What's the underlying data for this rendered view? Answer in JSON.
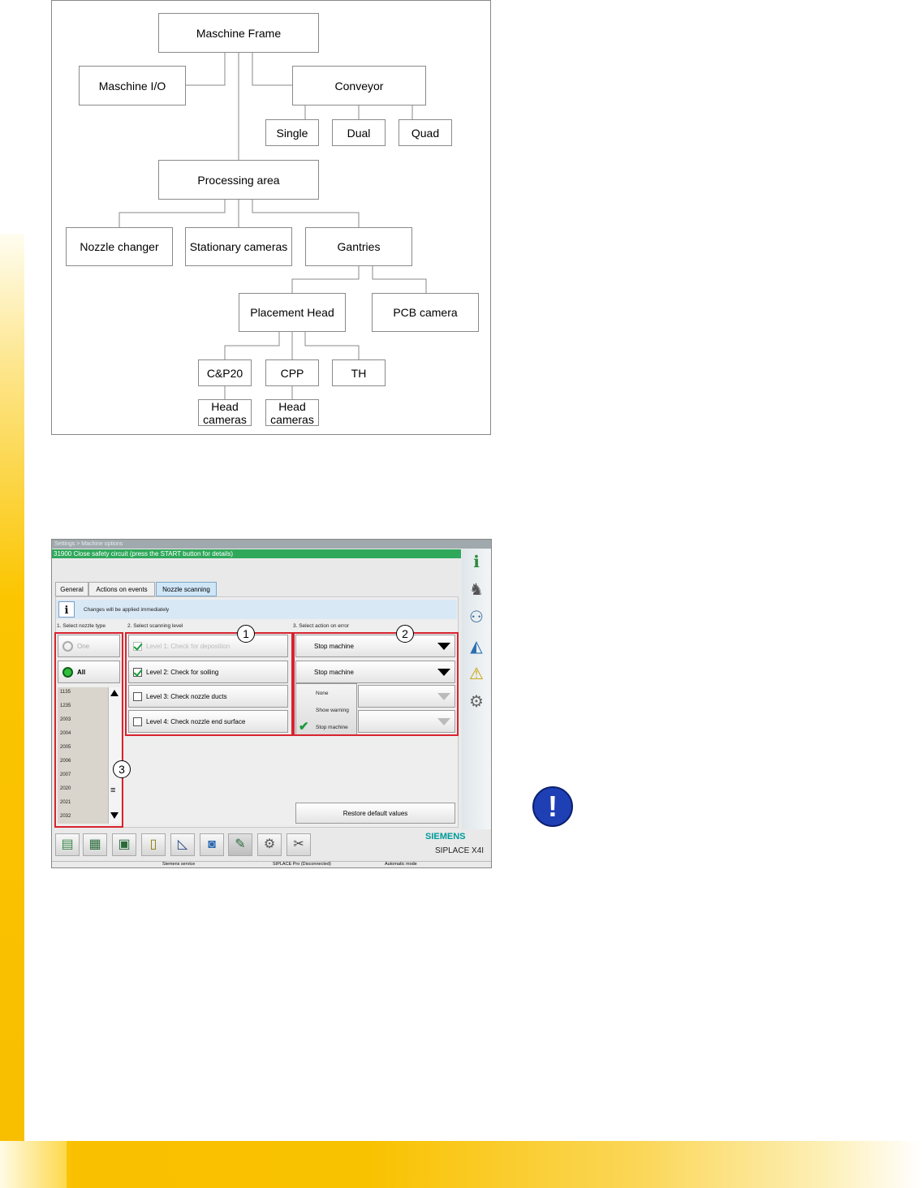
{
  "diagram": {
    "maschine_frame": "Maschine Frame",
    "maschine_io": "Maschine I/O",
    "conveyor": "Conveyor",
    "single": "Single",
    "dual": "Dual",
    "quad": "Quad",
    "processing_area": "Processing area",
    "nozzle_changer": "Nozzle changer",
    "stationary_cameras": "Stationary cameras",
    "gantries": "Gantries",
    "placement_head": "Placement Head",
    "pcb_camera": "PCB camera",
    "cp20": "C&P20",
    "cpp": "CPP",
    "th": "TH",
    "head_cameras_1": "Head cameras",
    "head_cameras_2": "Head cameras"
  },
  "screen": {
    "breadcrumb": "Settings > Machine options",
    "alarm": "31900 Close safety circuit (press the START button for details)",
    "tabs": [
      "General",
      "Actions on events",
      "Nozzle scanning"
    ],
    "info_text": "Changes will be applied immediately",
    "section1": "1. Select nozzle type",
    "section2": "2. Select scanning level",
    "section3": "3. Select action on error",
    "nozzle_one": "One",
    "nozzle_all": "All",
    "nozzle_list": [
      "1135",
      "1235",
      "2003",
      "2004",
      "2005",
      "2006",
      "2007",
      "2020",
      "2021",
      "2032"
    ],
    "levels": [
      "Level 1: Check for deposition",
      "Level 2: Check for soiling",
      "Level 3: Check nozzle ducts",
      "Level 4: Check nozzle end surface"
    ],
    "action_1": "Stop machine",
    "action_2": "Stop machine",
    "dropdown_options": [
      "None",
      "Show warning",
      "Stop machine"
    ],
    "restore": "Restore default values",
    "brand": "SIEMENS",
    "model": "SIPLACE X4I",
    "status": [
      "Siemens service",
      "SIPLACE Pro (Disconnected)",
      "Automatic mode"
    ],
    "callouts": [
      "1",
      "2",
      "3"
    ],
    "colors": {
      "alarm": "#2fa85a",
      "highlight": "#d9232e",
      "brand": "#009999"
    }
  },
  "notice_icon": "exclamation-icon"
}
